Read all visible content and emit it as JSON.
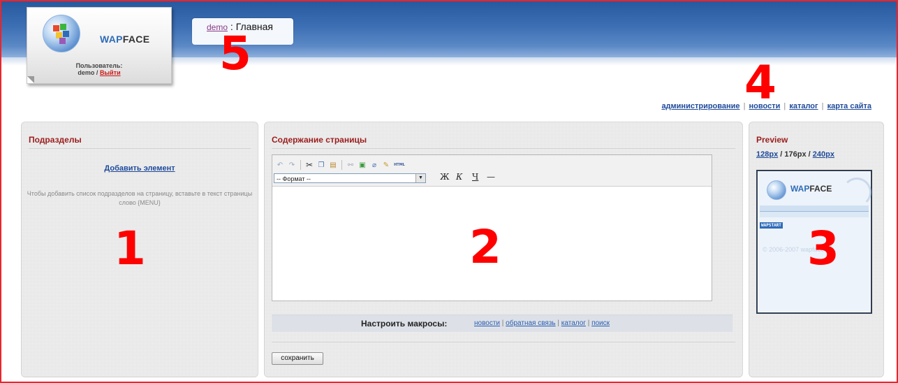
{
  "header": {
    "brand": {
      "wap": "WAP",
      "face": "FACE"
    },
    "user_label": "Пользователь:",
    "user_name": "demo",
    "user_sep": "/",
    "logout_label": "Выйти"
  },
  "breadcrumb": {
    "link": "demo",
    "sep": ":",
    "current": "Главная"
  },
  "markers": {
    "m1": "1",
    "m2": "2",
    "m3": "3",
    "m4": "4",
    "m5": "5"
  },
  "topnav": {
    "items": [
      "администрирование",
      "новости",
      "каталог",
      "карта сайта"
    ],
    "sep": "|"
  },
  "subsections": {
    "title": "Подразделы",
    "add_label": "Добавить элемент",
    "hint": "Чтобы добавить список подразделов на страницу, вставьте в текст страницы слово {MENU}"
  },
  "content": {
    "title": "Содержание страницы",
    "format_select": "-- Формат --",
    "bold": "Ж",
    "italic": "К",
    "underline": "Ч",
    "hr": "—",
    "html_btn": "HTML",
    "macro_label": "Настроить макросы:",
    "macro_links": [
      "новости",
      "обратная связь",
      "каталог",
      "поиск"
    ],
    "save_label": "сохранить"
  },
  "preview": {
    "title": "Preview",
    "sizes": [
      "128px",
      "176px",
      "240px"
    ],
    "size_sep": "/",
    "mini_brand": {
      "wap": "WAP",
      "face": "FACE"
    },
    "mini_badge": "WAPSTART",
    "mini_copy": "© 2006-2007 wapface"
  },
  "icons": [
    "undo-icon",
    "redo-icon",
    "cut-icon",
    "copy-icon",
    "paste-icon",
    "link-icon",
    "image-icon",
    "eraser-icon",
    "clean-icon",
    "html-icon"
  ],
  "colors": {
    "frame": "#e8262c",
    "header": "#3d6fb4",
    "title": "#9b1c1c",
    "link": "#1f4a9a",
    "marker": "#ff0000"
  }
}
